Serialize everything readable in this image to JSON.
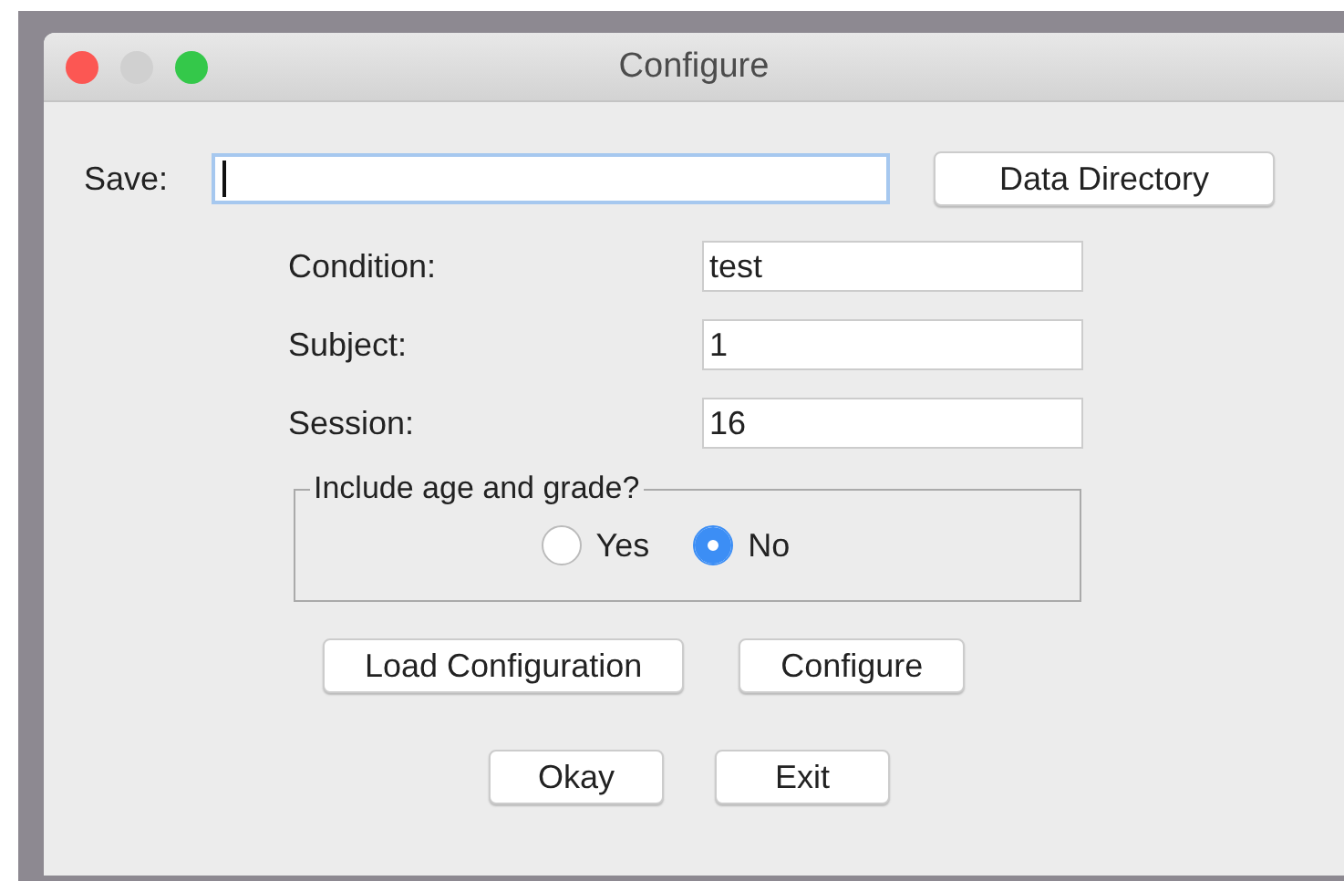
{
  "window": {
    "title": "Configure"
  },
  "save": {
    "label": "Save:",
    "focused": true,
    "button": "Data Directory"
  },
  "fields": [
    {
      "label": "Condition:",
      "value": "test"
    },
    {
      "label": "Subject:",
      "value": "1"
    },
    {
      "label": "Session:",
      "value": "16"
    }
  ],
  "group": {
    "legend": "Include age and grade?",
    "options": [
      {
        "label": "Yes",
        "selected": false
      },
      {
        "label": "No",
        "selected": true
      }
    ]
  },
  "button_rows": [
    [
      "Load Configuration",
      "Configure"
    ],
    [
      "Okay",
      "Exit"
    ]
  ]
}
